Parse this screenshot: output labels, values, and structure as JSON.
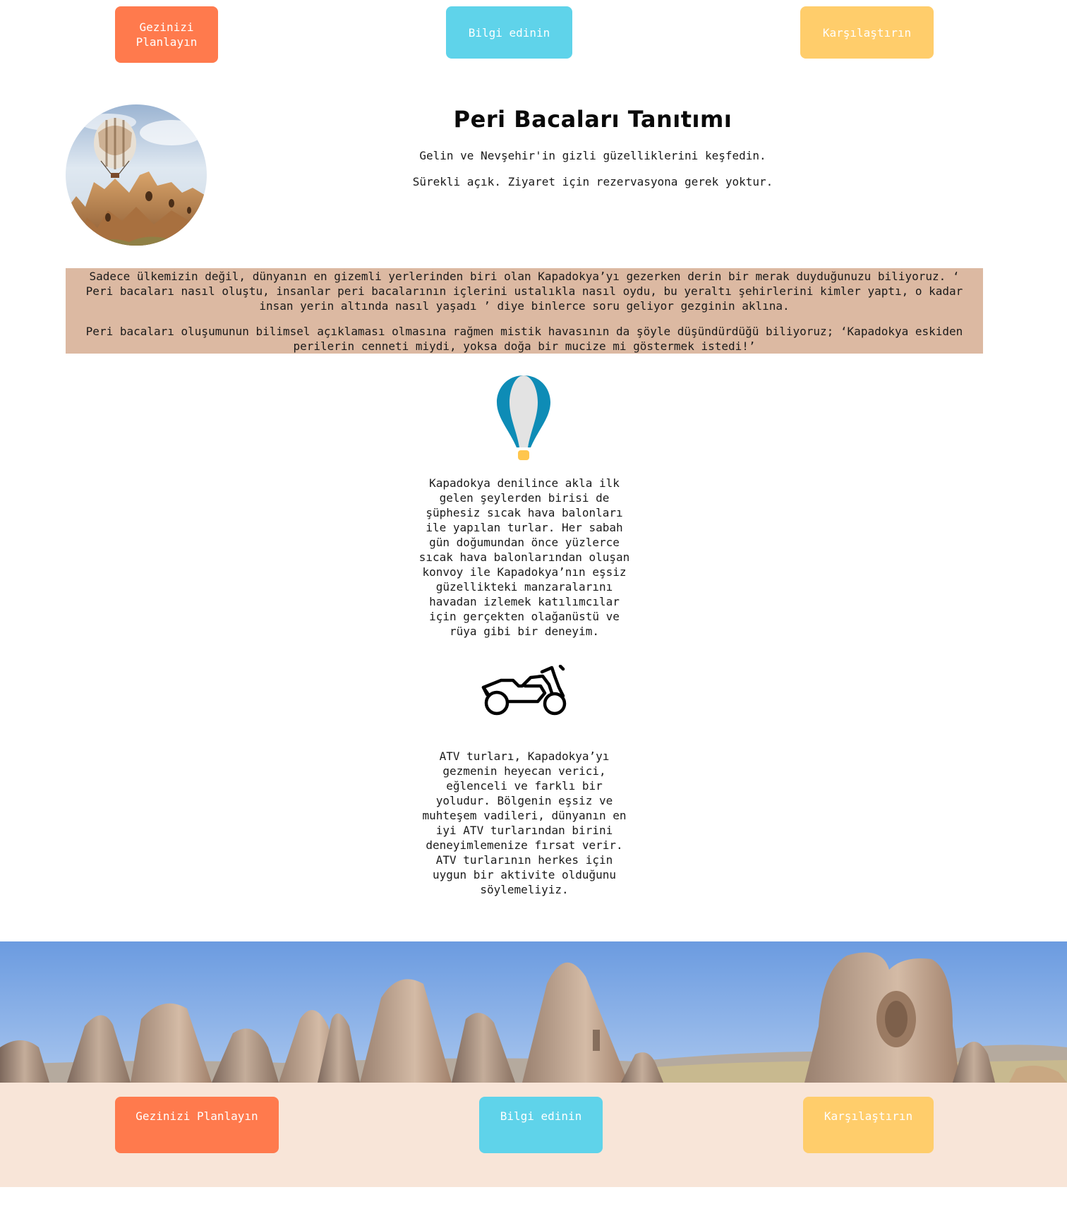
{
  "top_nav": {
    "plan_label": "Gezinizi Planlayın",
    "info_label": "Bilgi edinin",
    "compare_label": "Karşılaştırın"
  },
  "header": {
    "title": "Peri Bacaları Tanıtımı",
    "subtitle": "Gelin ve Nevşehir'in gizli güzelliklerini keşfedin.",
    "note": "Sürekli açık. Ziyaret için rezervasyona gerek yoktur."
  },
  "intro": {
    "paragraph_1": "Sadece ülkemizin değil, dünyanın en gizemli yerlerinden biri olan Kapadokya’yı gezerken derin bir merak duyduğunuzu biliyoruz. ‘ Peri bacaları nasıl oluştu, insanlar peri bacalarının içlerini ustalıkla nasıl oydu, bu yeraltı şehirlerini kimler yaptı, o kadar insan yerin altında nasıl yaşadı ’ diye binlerce soru geliyor gezginin aklına.",
    "paragraph_2": "Peri bacaları oluşumunun bilimsel açıklaması olmasına rağmen mistik havasının da şöyle düşündürdüğü biliyoruz; ‘Kapadokya eskiden perilerin cenneti miydi, yoksa doğa bir mucize mi göstermek istedi!’"
  },
  "features": [
    {
      "icon": "hot-air-balloon-icon",
      "text": "Kapadokya denilince akla ilk gelen şeylerden birisi de şüphesiz sıcak hava balonları ile yapılan turlar. Her sabah gün doğumundan önce yüzlerce sıcak hava balonlarından oluşan konvoy ile Kapadokya’nın eşsiz güzellikteki manzaralarını havadan izlemek katılımcılar için gerçekten olağanüstü ve rüya gibi bir deneyim."
    },
    {
      "icon": "atv-icon",
      "text": "ATV turları, Kapadokya’yı gezmenin heyecan verici, eğlenceli ve farklı bir yoludur. Bölgenin eşsiz ve muhteşem vadileri, dünyanın en iyi ATV turlarından birini deneyimlemenize fırsat verir. ATV turlarının herkes için uygun bir aktivite olduğunu söylemeliyiz."
    }
  ],
  "bottom_nav": {
    "plan_label": "Gezinizi Planlayın",
    "info_label": "Bilgi edinin",
    "compare_label": "Karşılaştırın"
  },
  "colors": {
    "orange": "#ff7a4d",
    "blue": "#5fd3ea",
    "yellow": "#ffcd6b",
    "intro_bg": "#dcb9a2",
    "footer_bg": "#f8e5d8"
  }
}
